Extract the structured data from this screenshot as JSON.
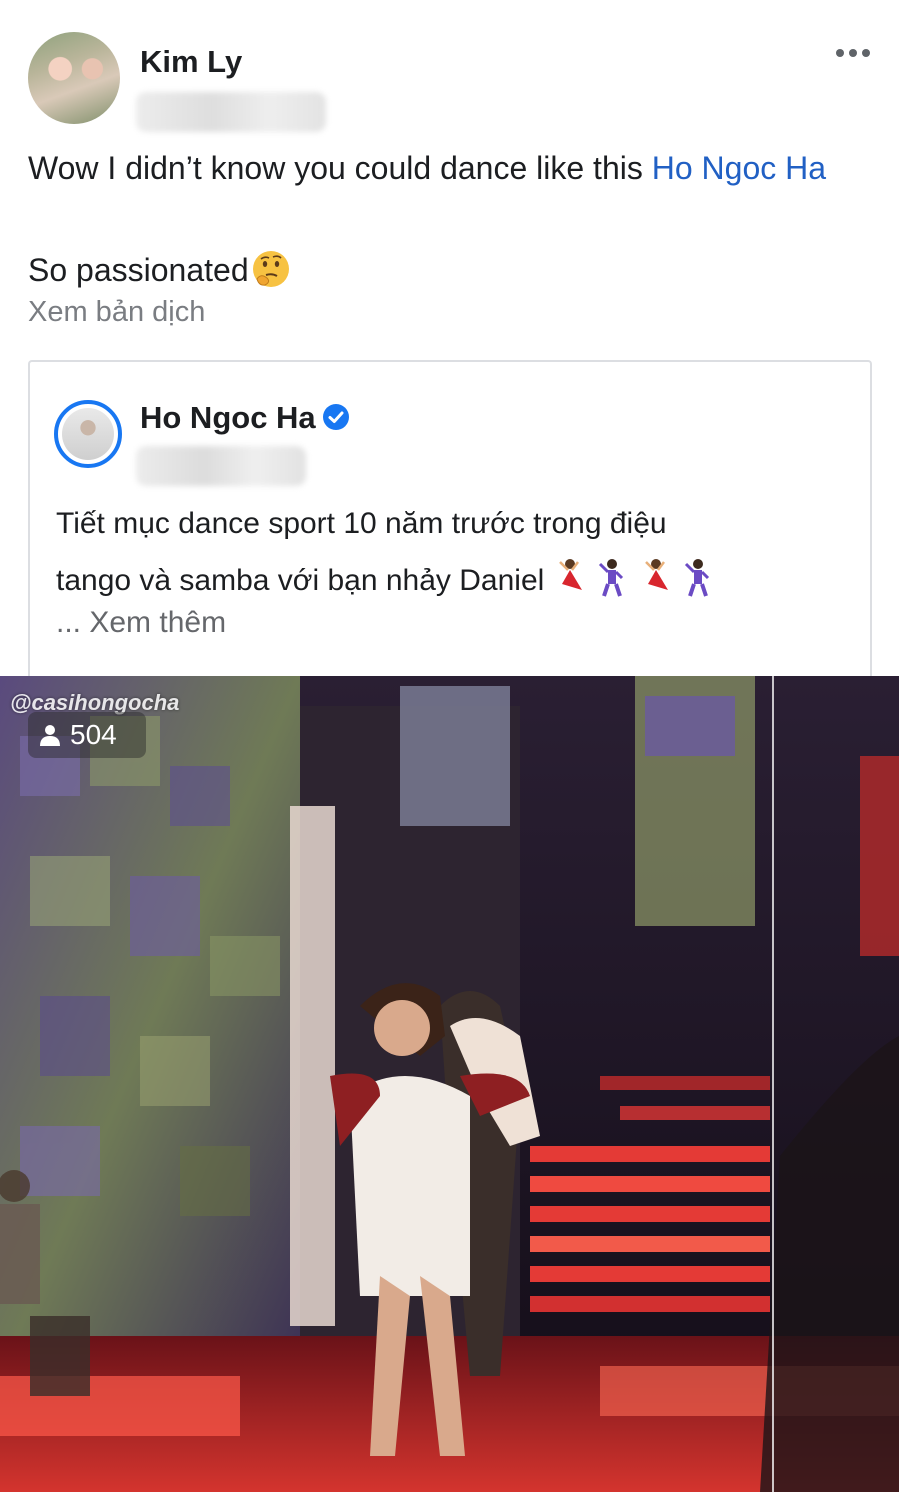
{
  "post": {
    "author": "Kim Ly",
    "text_line1": "Wow I didn’t know you could dance like this ",
    "mention": "Ho Ngoc Ha",
    "text_line2": "So passionated",
    "translate_label": "Xem bản dịch",
    "more_icon": "more-horizontal-icon"
  },
  "shared": {
    "author": "Ho Ngoc Ha",
    "verified_icon": "verified-badge-icon",
    "text_line1": "Tiết mục dance sport 10 năm trước trong điệu",
    "text_line2": "tango và samba với bạn nhảy Daniel",
    "see_more": "... Xem thêm"
  },
  "video": {
    "watermark": "@casihongocha",
    "viewer_count": "504",
    "viewer_icon": "person-icon"
  },
  "colors": {
    "mention": "#2160c4",
    "verified": "#1877f2",
    "muted_text": "#65676b"
  }
}
